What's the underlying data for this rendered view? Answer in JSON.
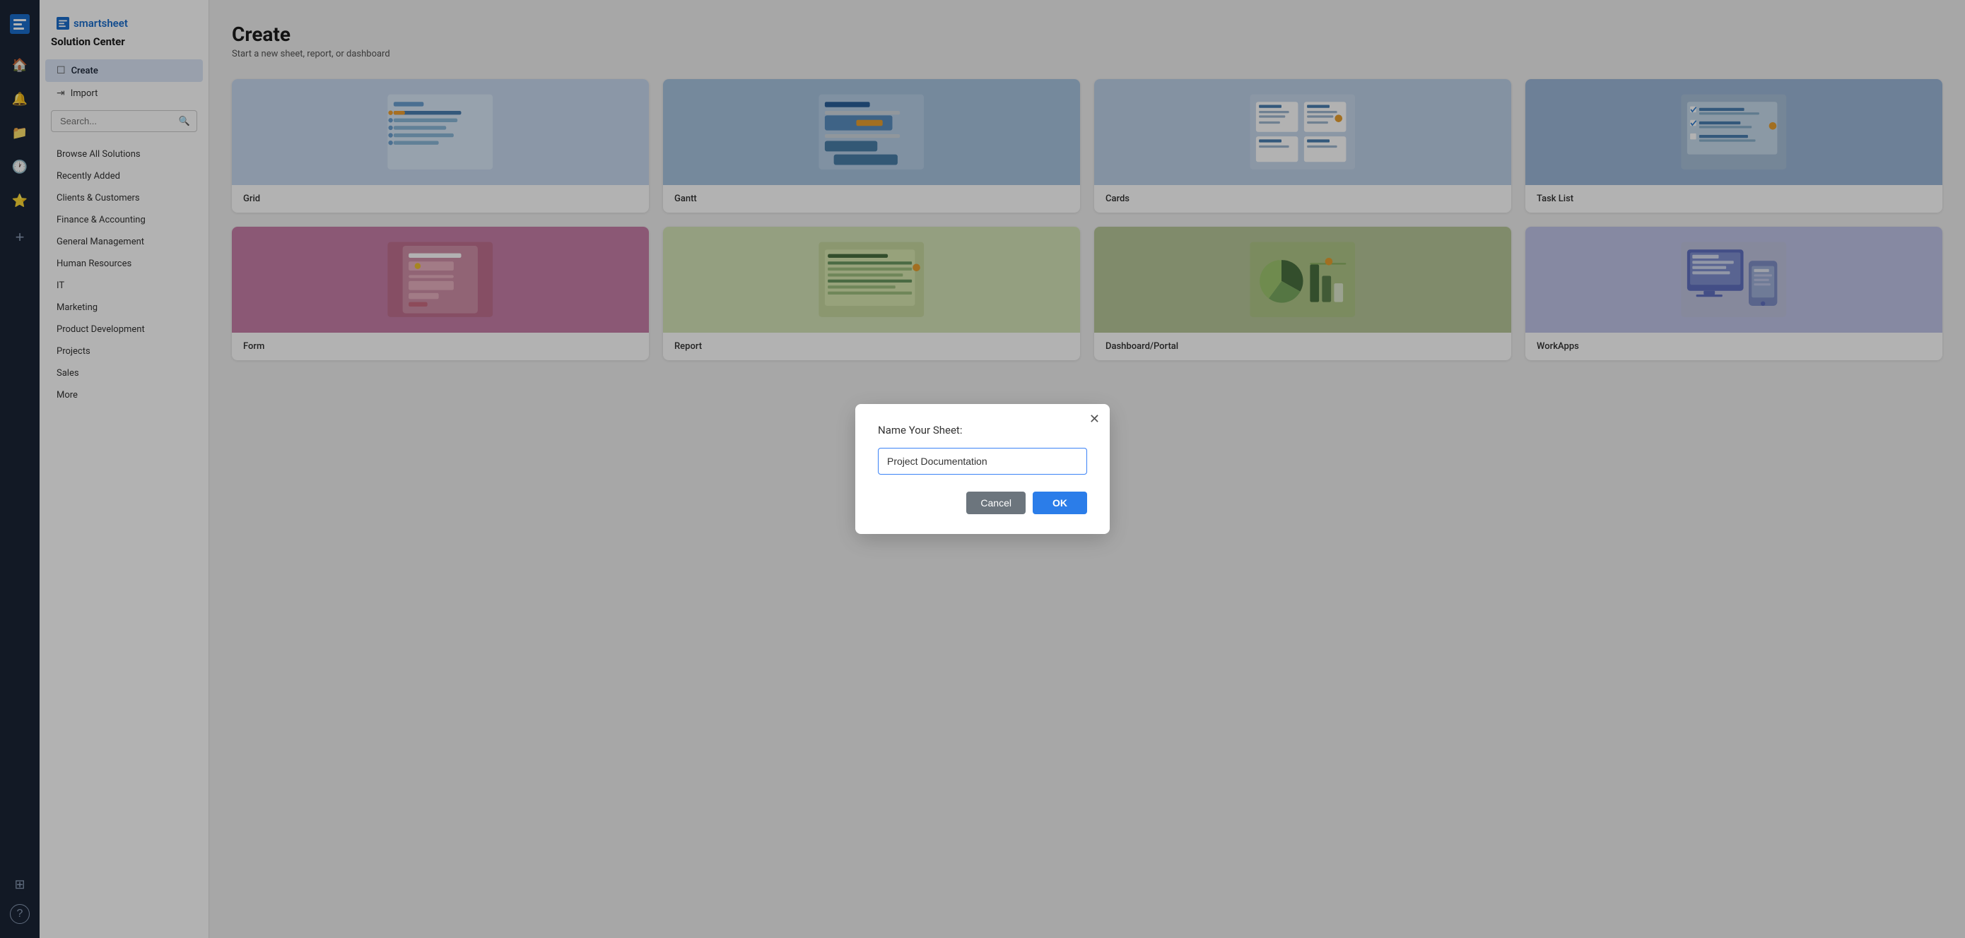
{
  "app": {
    "name": "smartsheet"
  },
  "nav": {
    "icons": [
      "home",
      "bell",
      "folder",
      "clock",
      "star",
      "add",
      "apps",
      "help"
    ]
  },
  "sidebar": {
    "title": "Solution Center",
    "search_placeholder": "Search...",
    "active_item": "create",
    "items": [
      {
        "id": "create",
        "label": "Create",
        "icon": "doc"
      },
      {
        "id": "import",
        "label": "Import",
        "icon": "import"
      },
      {
        "id": "browse",
        "label": "Browse All Solutions",
        "icon": null
      },
      {
        "id": "recently-added",
        "label": "Recently Added",
        "icon": null
      },
      {
        "id": "clients-customers",
        "label": "Clients & Customers",
        "icon": null
      },
      {
        "id": "finance-accounting",
        "label": "Finance & Accounting",
        "icon": null
      },
      {
        "id": "general-management",
        "label": "General Management",
        "icon": null
      },
      {
        "id": "human-resources",
        "label": "Human Resources",
        "icon": null
      },
      {
        "id": "it",
        "label": "IT",
        "icon": null
      },
      {
        "id": "marketing",
        "label": "Marketing",
        "icon": null
      },
      {
        "id": "product-development",
        "label": "Product Development",
        "icon": null
      },
      {
        "id": "projects",
        "label": "Projects",
        "icon": null
      },
      {
        "id": "sales",
        "label": "Sales",
        "icon": null
      },
      {
        "id": "more",
        "label": "More",
        "icon": null
      }
    ]
  },
  "page": {
    "title": "Create",
    "subtitle": "Start a new sheet, report, or dashboard"
  },
  "cards": [
    {
      "id": "grid",
      "label": "Grid",
      "theme": "grid"
    },
    {
      "id": "gantt",
      "label": "Gantt",
      "theme": "gantt"
    },
    {
      "id": "cards",
      "label": "Cards",
      "theme": "cards"
    },
    {
      "id": "task-list",
      "label": "Task List",
      "theme": "tasklist"
    },
    {
      "id": "form",
      "label": "Form",
      "theme": "form"
    },
    {
      "id": "report",
      "label": "Report",
      "theme": "report"
    },
    {
      "id": "dashboard-portal",
      "label": "Dashboard/Portal",
      "theme": "dashboard"
    },
    {
      "id": "workapps",
      "label": "WorkApps",
      "theme": "workapps"
    }
  ],
  "modal": {
    "title": "Name Your Sheet:",
    "input_value": "Project Documentation",
    "cancel_label": "Cancel",
    "ok_label": "OK"
  }
}
